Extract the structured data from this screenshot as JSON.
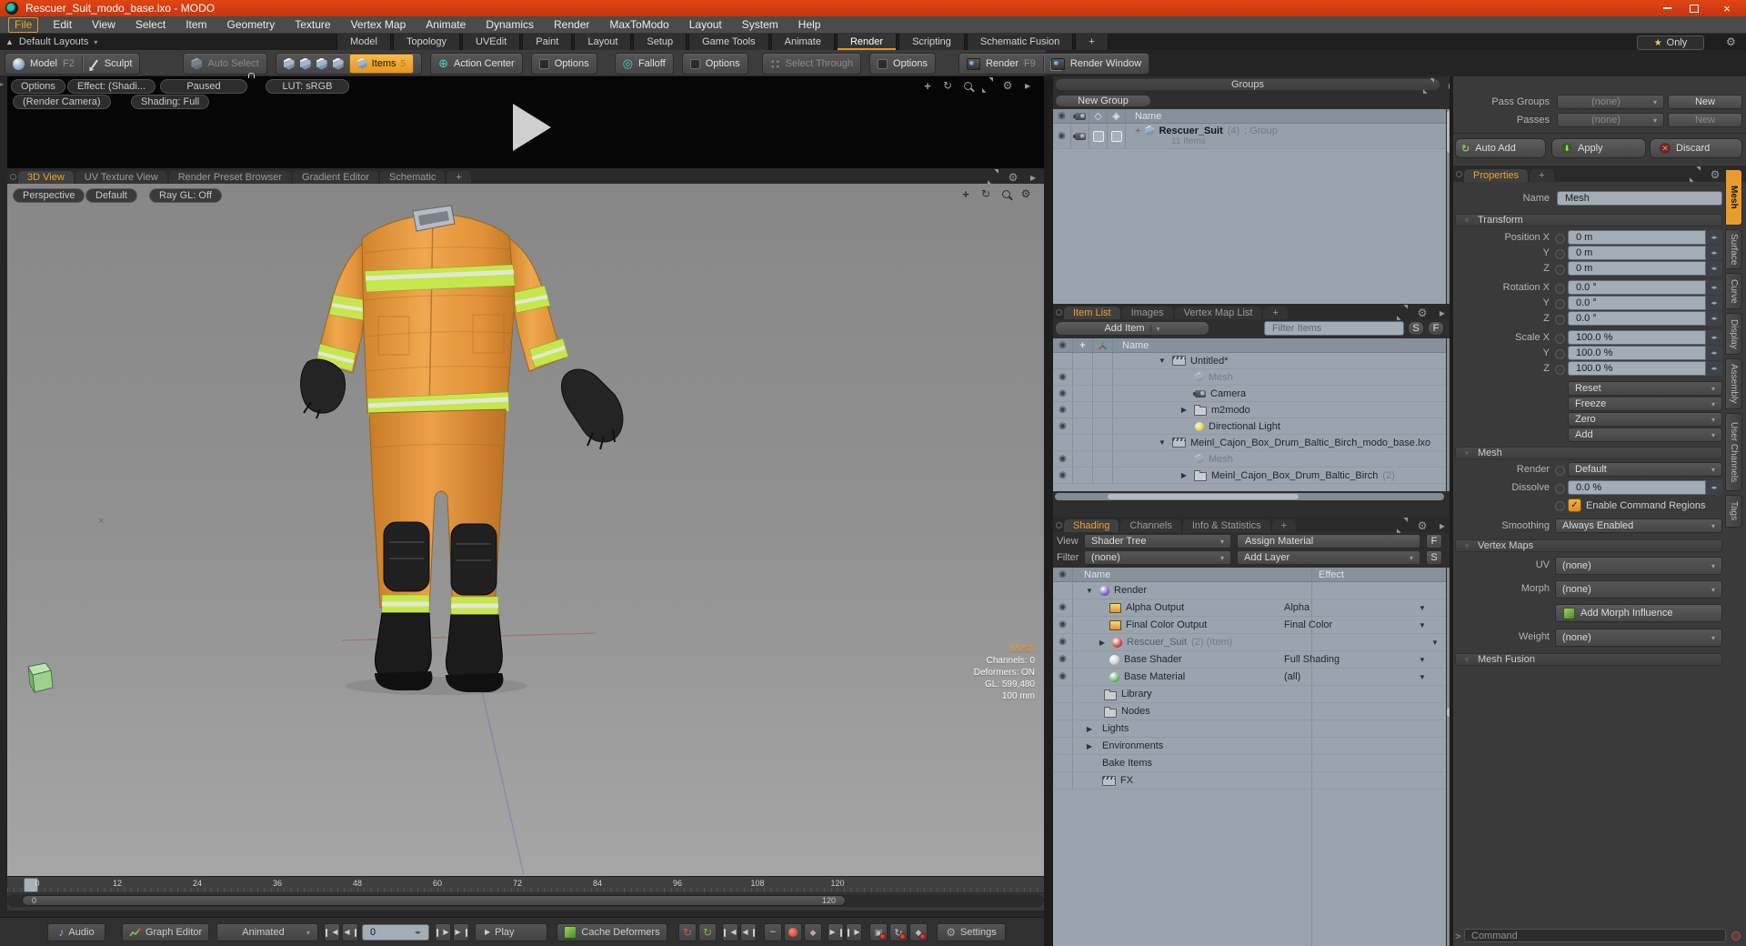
{
  "window": {
    "title": "Rescuer_Suit_modo_base.lxo - MODO"
  },
  "menu": {
    "items": [
      "File",
      "Edit",
      "View",
      "Select",
      "Item",
      "Geometry",
      "Texture",
      "Vertex Map",
      "Animate",
      "Dynamics",
      "Render",
      "MaxToModo",
      "Layout",
      "System",
      "Help"
    ]
  },
  "layout_bar": {
    "layouts_label": "Default Layouts",
    "tabs": [
      "Model",
      "Topology",
      "UVEdit",
      "Paint",
      "Layout",
      "Setup",
      "Game Tools",
      "Animate",
      "Render",
      "Scripting",
      "Schematic Fusion",
      "+"
    ],
    "only_label": "Only"
  },
  "toolbar": {
    "model": "Model",
    "model_key": "F2",
    "sculpt": "Sculpt",
    "auto_select": "Auto Select",
    "items": "Items",
    "items_count": "5",
    "action_center": "Action Center",
    "options_a": "Options",
    "falloff": "Falloff",
    "options_b": "Options",
    "select_through": "Select Through",
    "options_c": "Options",
    "render": "Render",
    "render_key": "F9",
    "render_window": "Render Window"
  },
  "render_strip": {
    "options": "Options",
    "effect": "Effect: (Shadi...",
    "paused": "Paused",
    "lut": "LUT: sRGB",
    "camera": "(Render Camera)",
    "shading": "Shading: Full"
  },
  "view_tabs": {
    "tabs": [
      "3D View",
      "UV Texture View",
      "Render Preset Browser",
      "Gradient Editor",
      "Schematic"
    ],
    "add": "+"
  },
  "viewport": {
    "perspective": "Perspective",
    "default": "Default",
    "raygl": "Ray GL: Off",
    "info_title": "Mesh",
    "info": [
      "Channels: 0",
      "Deformers: ON",
      "GL: 599,480",
      "100 mm"
    ]
  },
  "timeline": {
    "ticks": [
      "0",
      "12",
      "24",
      "36",
      "48",
      "60",
      "72",
      "84",
      "96",
      "108",
      "120"
    ],
    "range_start": "0",
    "range_end": "120"
  },
  "transport": {
    "audio": "Audio",
    "graph_editor": "Graph Editor",
    "mode": "Animated",
    "frame": "0",
    "play": "Play",
    "cache_deformers": "Cache Deformers",
    "settings": "Settings"
  },
  "groups": {
    "title": "Groups",
    "new_group": "New Group",
    "name_col": "Name",
    "row": {
      "name": "Rescuer_Suit",
      "count": "(4)",
      "type": ": Group",
      "items": "11 Items"
    }
  },
  "item_list": {
    "tabs": [
      "Item List",
      "Images",
      "Vertex Map List",
      "+"
    ],
    "add_item": "Add Item",
    "filter_placeholder": "Filter Items",
    "s": "S",
    "f": "F",
    "name_col": "Name",
    "rows": [
      {
        "label": "Untitled*"
      },
      {
        "label": "Mesh"
      },
      {
        "label": "Camera"
      },
      {
        "label": "m2modo"
      },
      {
        "label": "Directional Light"
      },
      {
        "label": "Meinl_Cajon_Box_Drum_Baltic_Birch_modo_base.lxo"
      },
      {
        "label": "Mesh"
      },
      {
        "label": "Meinl_Cajon_Box_Drum_Baltic_Birch",
        "suffix": "(2)"
      }
    ]
  },
  "shading": {
    "tabs": [
      "Shading",
      "Channels",
      "Info & Statistics",
      "+"
    ],
    "view_label": "View",
    "view_value": "Shader Tree",
    "assign_material": "Assign Material",
    "f": "F",
    "filter_label": "Filter",
    "filter_value": "(none)",
    "add_layer": "Add Layer",
    "s": "S",
    "name_col": "Name",
    "effect_col": "Effect",
    "rows": [
      {
        "label": "Render",
        "effect": ""
      },
      {
        "label": "Alpha Output",
        "effect": "Alpha"
      },
      {
        "label": "Final Color Output",
        "effect": "Final Color"
      },
      {
        "label": "Rescuer_Suit",
        "suffix": "(2) (Item)",
        "effect": ""
      },
      {
        "label": "Base Shader",
        "effect": "Full Shading"
      },
      {
        "label": "Base Material",
        "effect": "(all)"
      },
      {
        "label": "Library"
      },
      {
        "label": "Nodes"
      },
      {
        "label": "Lights"
      },
      {
        "label": "Environments"
      },
      {
        "label": "Bake Items"
      },
      {
        "label": "FX"
      }
    ]
  },
  "properties": {
    "pass_groups": "Pass Groups",
    "pass_groups_value": "(none)",
    "new_a": "New",
    "passes": "Passes",
    "passes_value": "(none)",
    "new_b": "New",
    "auto_add": "Auto Add",
    "apply": "Apply",
    "discard": "Discard",
    "tab": "Properties",
    "add_tab": "+",
    "name_label": "Name",
    "name_value": "Mesh",
    "transform": {
      "header": "Transform",
      "rows": [
        [
          "Position X",
          "0 m"
        ],
        [
          "Y",
          "0 m"
        ],
        [
          "Z",
          "0 m"
        ],
        [
          "Rotation X",
          "0.0 °"
        ],
        [
          "Y",
          "0.0 °"
        ],
        [
          "Z",
          "0.0 °"
        ],
        [
          "Scale X",
          "100.0 %"
        ],
        [
          "Y",
          "100.0 %"
        ],
        [
          "Z",
          "100.0 %"
        ]
      ],
      "buttons": [
        "Reset",
        "Freeze",
        "Zero",
        "Add"
      ]
    },
    "mesh": {
      "header": "Mesh",
      "render_label": "Render",
      "render_value": "Default",
      "dissolve_label": "Dissolve",
      "dissolve_value": "0.0 %",
      "enable_cr": "Enable Command Regions",
      "smoothing_label": "Smoothing",
      "smoothing_value": "Always Enabled"
    },
    "vertex_maps": {
      "header": "Vertex Maps",
      "uv_label": "UV",
      "uv_value": "(none)",
      "morph_label": "Morph",
      "morph_value": "(none)",
      "add_morph": "Add Morph Influence",
      "weight_label": "Weight",
      "weight_value": "(none)"
    },
    "mesh_fusion": "Mesh Fusion",
    "side_tabs": [
      "Mesh",
      "Surface",
      "Curve",
      "Display",
      "Assembly",
      "User Channels",
      "Tags"
    ]
  },
  "command": {
    "prompt": ">",
    "placeholder": "Command"
  },
  "colors": {
    "accent": "#f0a030",
    "titlebar": "#d23b10",
    "suit_orange": "#e89a3c",
    "stripe_green": "#c6e64e"
  }
}
